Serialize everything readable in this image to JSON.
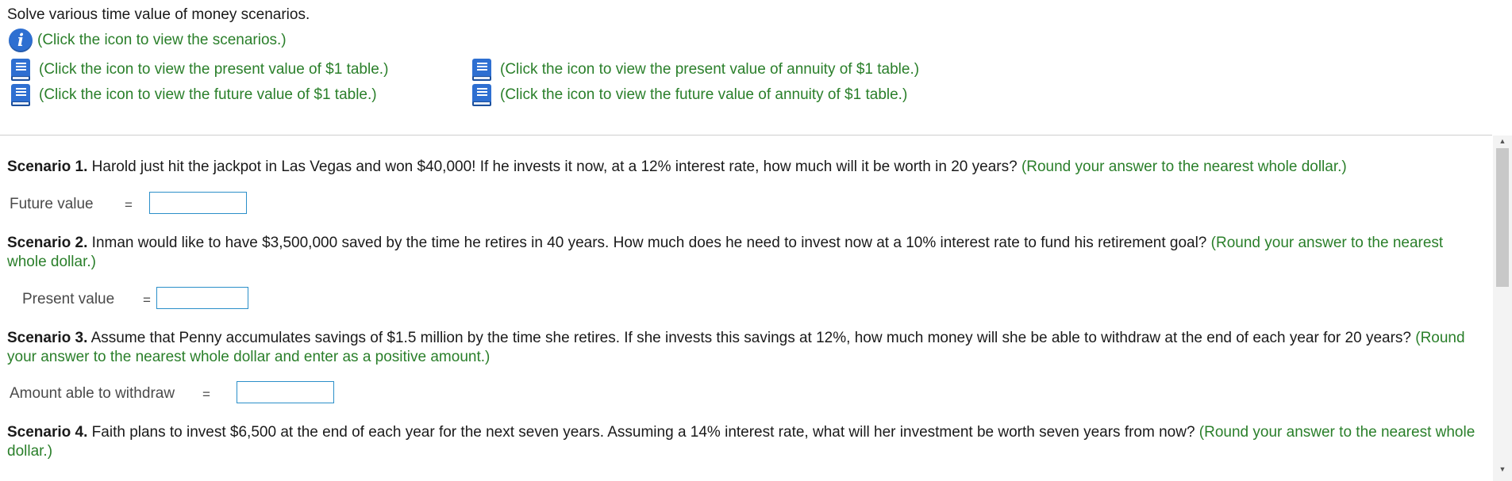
{
  "header": {
    "title": "Solve various time value of money scenarios.",
    "info_link": "(Click the icon to view the scenarios.)",
    "tables": {
      "pv": "(Click the icon to view the present value of $1 table.)",
      "fv": "(Click the icon to view the future value of $1 table.)",
      "pva": "(Click the icon to view the present value of annuity of $1 table.)",
      "fva": "(Click the icon to view the future value of annuity of $1 table.)"
    }
  },
  "scenarios": [
    {
      "label": "Scenario 1.",
      "text": " Harold just hit the jackpot in Las Vegas and won $40,000! If he invests it now, at a 12% interest rate, how much will it be worth in 20 years? ",
      "hint": "(Round your answer to the nearest whole dollar.)",
      "answer_label": "Future value",
      "equals": "=",
      "value": ""
    },
    {
      "label": "Scenario 2.",
      "text": " Inman would like to have $3,500,000 saved by the time he retires in 40 years. How much does he need to invest now at a 10% interest rate to fund his retirement goal? ",
      "hint": "(Round your answer to the nearest whole dollar.)",
      "answer_label": "Present value",
      "equals": "=",
      "value": ""
    },
    {
      "label": "Scenario 3.",
      "text": " Assume that Penny accumulates savings of $1.5 million by the time she retires. If she invests this savings at 12%, how much money will she be able to withdraw at the end of each year for 20 years? ",
      "hint": "(Round your answer to the nearest whole dollar and enter as a positive amount.)",
      "answer_label": "Amount able to withdraw",
      "equals": "=",
      "value": ""
    },
    {
      "label": "Scenario 4.",
      "text": " Faith plans to invest $6,500 at the end of each year for the next seven years. Assuming a 14% interest rate, what will her investment be worth seven years from now? ",
      "hint": "(Round your answer to the nearest whole dollar.)"
    }
  ],
  "colors": {
    "link_green": "#2a7f2a",
    "icon_blue": "#2e6fd1",
    "input_border": "#2b8fc9"
  }
}
